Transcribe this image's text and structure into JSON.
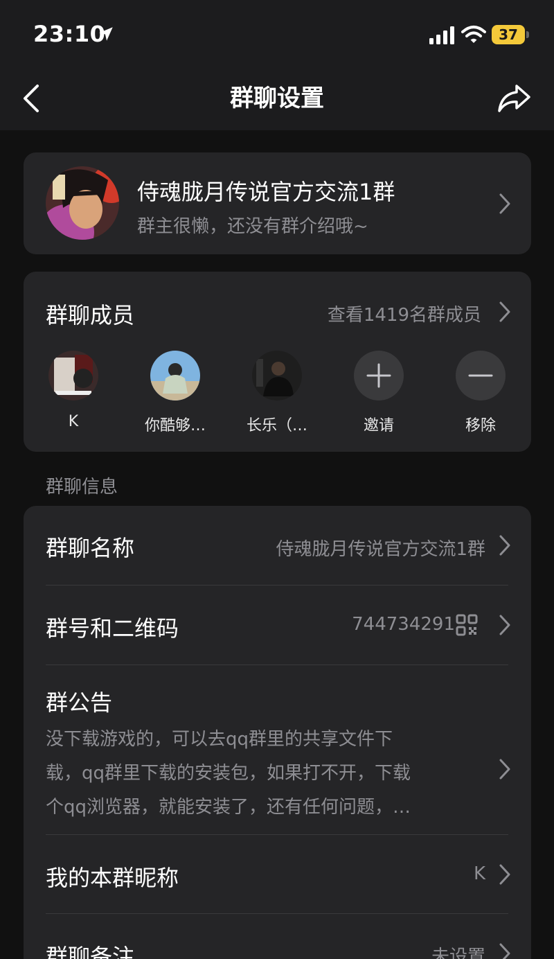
{
  "status_bar": {
    "time": "23:10",
    "battery": "37",
    "icons": [
      "location-arrow-icon",
      "signal-icon",
      "wifi-icon",
      "battery-icon"
    ]
  },
  "nav": {
    "title": "群聊设置",
    "back_icon": "chevron-left-icon",
    "share_icon": "share-arrow-icon"
  },
  "group": {
    "name": "侍魂胧月传说官方交流1群",
    "description": "群主很懒，还没有群介绍哦~"
  },
  "members": {
    "title": "群聊成员",
    "view_all": "查看1419名群成员",
    "list": [
      {
        "label": "K"
      },
      {
        "label": "你酷够…"
      },
      {
        "label": "长乐（…"
      }
    ],
    "invite_label": "邀请",
    "remove_label": "移除"
  },
  "info_section": {
    "label": "群聊信息",
    "name_label": "群聊名称",
    "name_value": "侍魂胧月传说官方交流1群",
    "id_label": "群号和二维码",
    "id_value": "744734291",
    "notice_label": "群公告",
    "notice_lines": [
      "没下载游戏的，可以去qq群里的共享文件下",
      "载，qq群里下载的安装包，如果打不开，下载",
      "个qq浏览器，就能安装了，还有任何问题，…"
    ],
    "nickname_label": "我的本群昵称",
    "nickname_value": "K",
    "remark_label": "群聊备注",
    "remark_value": "未设置"
  },
  "colors": {
    "background": "#111111",
    "card": "#252527",
    "secondary_text": "#8e8e93",
    "battery": "#f4c93a"
  }
}
